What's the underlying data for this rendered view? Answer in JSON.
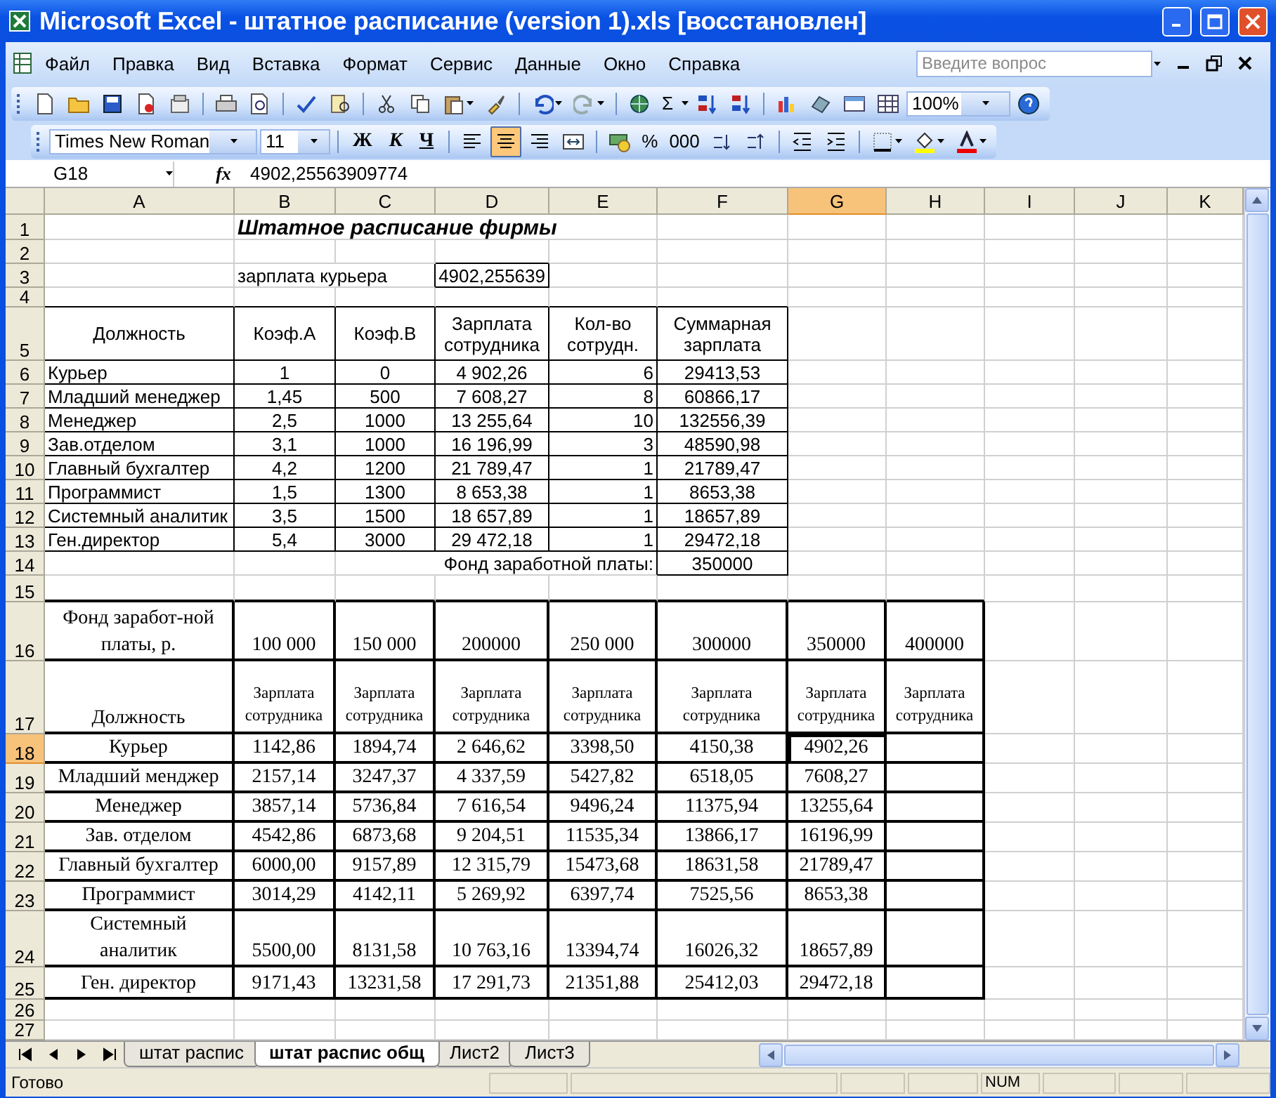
{
  "window": {
    "title": "Microsoft Excel - штатное расписание (version 1).xls  [восстановлен]"
  },
  "menu": [
    "Файл",
    "Правка",
    "Вид",
    "Вставка",
    "Формат",
    "Сервис",
    "Данные",
    "Окно",
    "Справка"
  ],
  "help_search": {
    "placeholder": "Введите вопрос"
  },
  "standard_toolbar": {
    "sum": "Σ",
    "zoom": "100%"
  },
  "formatting_toolbar": {
    "font": "Times New Roman",
    "size": "11",
    "bold": "Ж",
    "italic": "К",
    "underline": "Ч",
    "align": [
      {
        "selected": false
      },
      {
        "selected": true
      },
      {
        "selected": false
      }
    ],
    "percent": "%",
    "thousands": "000"
  },
  "formula_bar": {
    "name_box": "G18",
    "function_label": "fx",
    "formula": "4902,25563909774"
  },
  "columns": [
    {
      "label": "A",
      "selected": false
    },
    {
      "label": "B",
      "selected": false
    },
    {
      "label": "C",
      "selected": false
    },
    {
      "label": "D",
      "selected": false
    },
    {
      "label": "E",
      "selected": false
    },
    {
      "label": "F",
      "selected": false
    },
    {
      "label": "G",
      "selected": true
    },
    {
      "label": "H",
      "selected": false
    },
    {
      "label": "I",
      "selected": false
    },
    {
      "label": "J",
      "selected": false
    },
    {
      "label": "K",
      "selected": false
    }
  ],
  "rows": [
    {
      "number": "1",
      "selected": false,
      "cells": [
        null,
        "Штатное расписание фирмы"
      ]
    },
    {
      "number": "2",
      "selected": false
    },
    {
      "number": "3",
      "selected": false,
      "cells": [
        null,
        "зарплата курьера",
        null,
        "4902,255639"
      ]
    },
    {
      "number": "4",
      "selected": false
    },
    {
      "number": "5",
      "selected": false,
      "cells": [
        "Должность",
        "Коэф.А",
        "Коэф.В",
        "Зарплата\nсотрудника",
        "Кол-во\nсотрудн.",
        "Суммарная\nзарплата"
      ]
    },
    {
      "number": "6",
      "selected": false,
      "cells": [
        "Курьер",
        "1",
        "0",
        "4 902,26",
        "6",
        "29413,53"
      ]
    },
    {
      "number": "7",
      "selected": false,
      "cells": [
        "Младший менеджер",
        "1,45",
        "500",
        "7 608,27",
        "8",
        "60866,17"
      ]
    },
    {
      "number": "8",
      "selected": false,
      "cells": [
        "Менеджер",
        "2,5",
        "1000",
        "13 255,64",
        "10",
        "132556,39"
      ]
    },
    {
      "number": "9",
      "selected": false,
      "cells": [
        "Зав.отделом",
        "3,1",
        "1000",
        "16 196,99",
        "3",
        "48590,98"
      ]
    },
    {
      "number": "10",
      "selected": false,
      "cells": [
        "Главный бухгалтер",
        "4,2",
        "1200",
        "21 789,47",
        "1",
        "21789,47"
      ]
    },
    {
      "number": "11",
      "selected": false,
      "cells": [
        "Программист",
        "1,5",
        "1300",
        "8 653,38",
        "1",
        "8653,38"
      ]
    },
    {
      "number": "12",
      "selected": false,
      "cells": [
        "Системный аналитик",
        "3,5",
        "1500",
        "18 657,89",
        "1",
        "18657,89"
      ]
    },
    {
      "number": "13",
      "selected": false,
      "cells": [
        "Ген.директор",
        "5,4",
        "3000",
        "29 472,18",
        "1",
        "29472,18"
      ]
    },
    {
      "number": "14",
      "selected": false,
      "cells": [
        null,
        null,
        "Фонд заработной платы:",
        null,
        null,
        "350000"
      ]
    },
    {
      "number": "15",
      "selected": false
    },
    {
      "number": "16",
      "selected": false,
      "cells": [
        "Фонд заработ-ной\nплаты, р.",
        "100 000",
        "150 000",
        "200000",
        "250 000",
        "300000",
        "350000",
        "400000"
      ]
    },
    {
      "number": "17",
      "selected": false,
      "cells": [
        "Должность",
        "Зарплата\nсотрудника",
        "Зарплата\nсотрудника",
        "Зарплата\nсотрудника",
        "Зарплата\nсотрудника",
        "Зарплата\nсотрудника",
        "Зарплата\nсотрудника",
        "Зарплата\nсотрудника"
      ]
    },
    {
      "number": "18",
      "selected": true,
      "cells": [
        "Курьер",
        "1142,86",
        "1894,74",
        "2 646,62",
        "3398,50",
        "4150,38",
        "4902,26"
      ]
    },
    {
      "number": "19",
      "selected": false,
      "cells": [
        "Младший менджер",
        "2157,14",
        "3247,37",
        "4 337,59",
        "5427,82",
        "6518,05",
        "7608,27"
      ]
    },
    {
      "number": "20",
      "selected": false,
      "cells": [
        "Менеджер",
        "3857,14",
        "5736,84",
        "7 616,54",
        "9496,24",
        "11375,94",
        "13255,64"
      ]
    },
    {
      "number": "21",
      "selected": false,
      "cells": [
        "Зав. отделом",
        "4542,86",
        "6873,68",
        "9 204,51",
        "11535,34",
        "13866,17",
        "16196,99"
      ]
    },
    {
      "number": "22",
      "selected": false,
      "cells": [
        "Главный бухгалтер",
        "6000,00",
        "9157,89",
        "12 315,79",
        "15473,68",
        "18631,58",
        "21789,47"
      ]
    },
    {
      "number": "23",
      "selected": false,
      "cells": [
        "Программист",
        "3014,29",
        "4142,11",
        "5 269,92",
        "6397,74",
        "7525,56",
        "8653,38"
      ]
    },
    {
      "number": "24",
      "selected": false,
      "cells": [
        "Системный\nаналитик",
        "5500,00",
        "8131,58",
        "10 763,16",
        "13394,74",
        "16026,32",
        "18657,89"
      ]
    },
    {
      "number": "25",
      "selected": false,
      "cells": [
        "Ген. директор",
        "9171,43",
        "13231,58",
        "17 291,73",
        "21351,88",
        "25412,03",
        "29472,18"
      ]
    },
    {
      "number": "26",
      "selected": false
    },
    {
      "number": "27",
      "selected": false
    }
  ],
  "sheet_tabs": [
    {
      "label": "штат распис",
      "selected": false
    },
    {
      "label": "штат распис общ",
      "selected": true
    },
    {
      "label": "Лист2",
      "selected": false
    },
    {
      "label": "Лист3",
      "selected": false
    }
  ],
  "status_bar": {
    "status": "Готово",
    "num": "NUM"
  }
}
